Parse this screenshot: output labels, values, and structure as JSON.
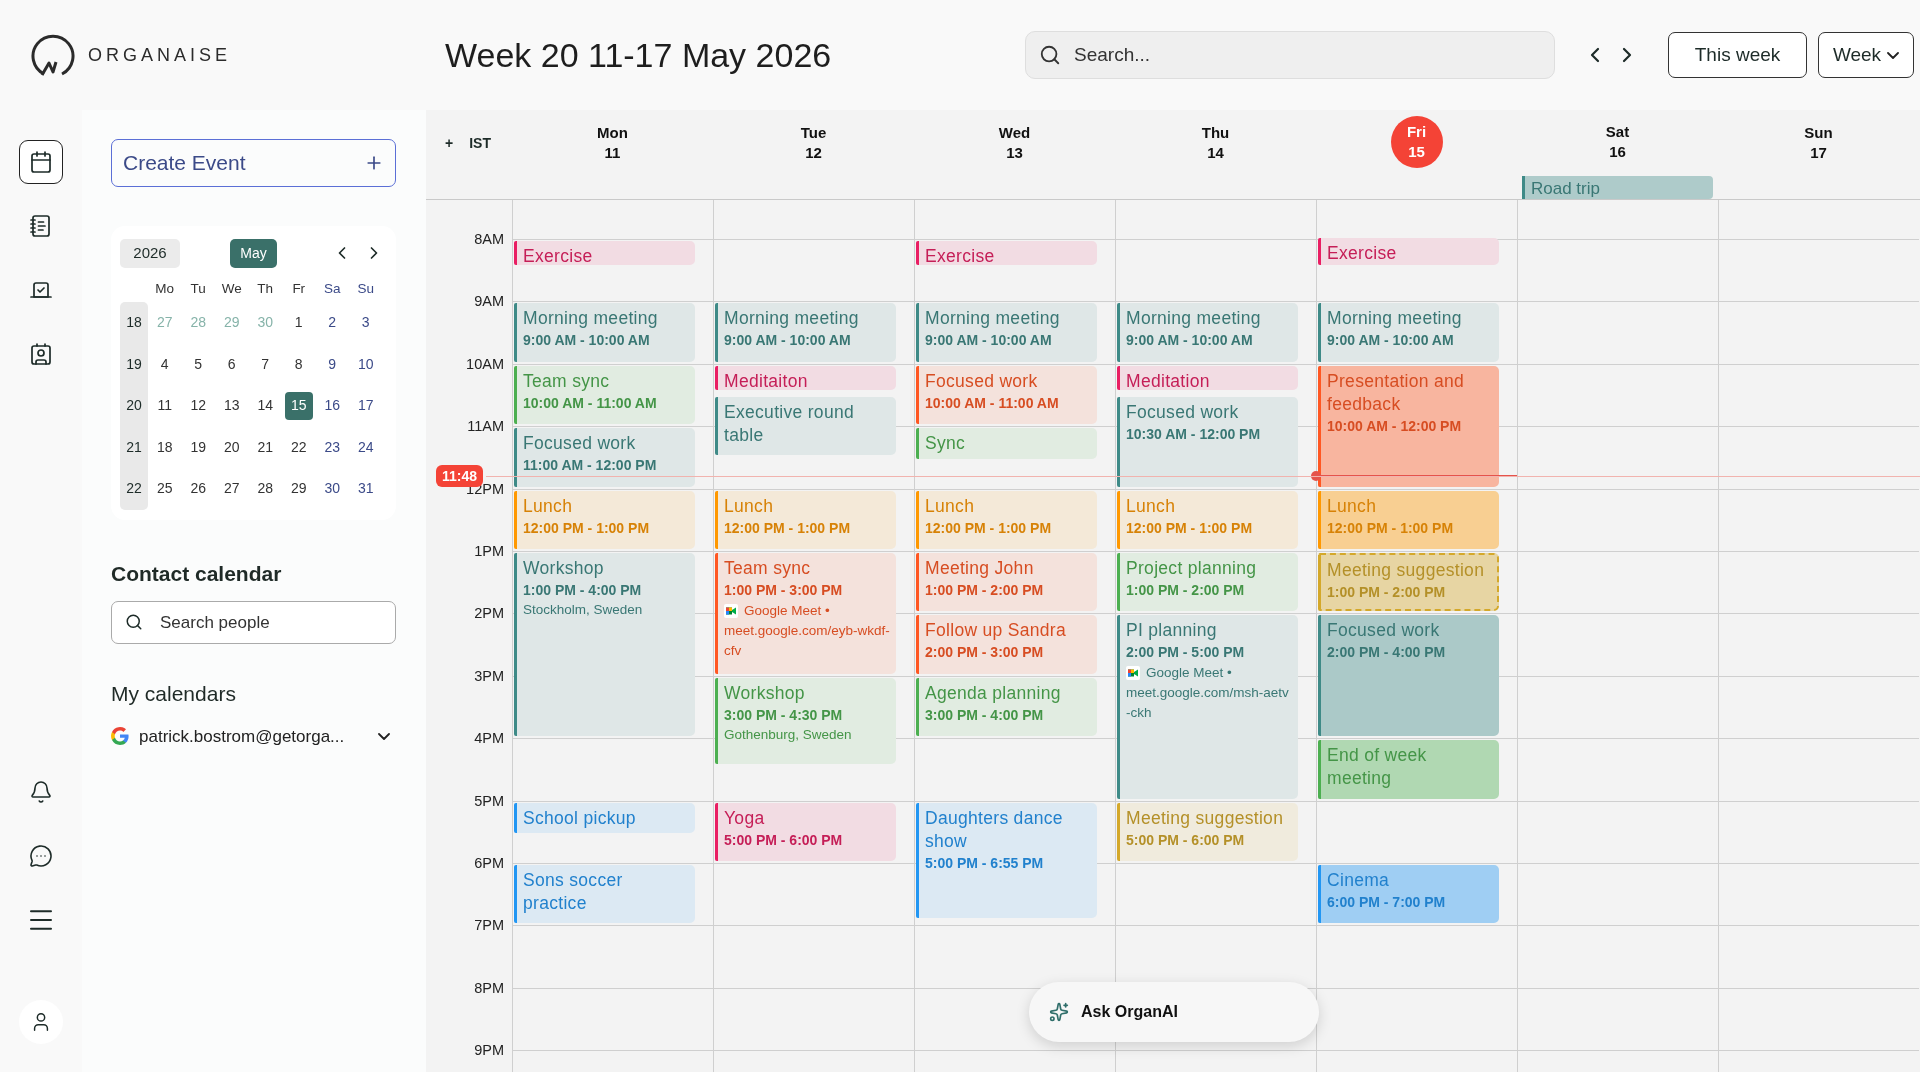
{
  "app": {
    "name": "ORGANAISE"
  },
  "header": {
    "title": "Week 20 11-17 May 2026",
    "search_placeholder": "Search...",
    "today_button": "This week",
    "view_button": "Week"
  },
  "nav_items": [
    {
      "kind": "calendar",
      "selected": true
    },
    {
      "kind": "notebook",
      "selected": false
    },
    {
      "kind": "ballot",
      "selected": false
    },
    {
      "kind": "contacts",
      "selected": false
    }
  ],
  "sidebar": {
    "create_button": "Create Event",
    "mini_calendar": {
      "year": "2026",
      "month": "May",
      "weekdays": [
        "Mo",
        "Tu",
        "We",
        "Th",
        "Fr",
        "Sa",
        "Su"
      ],
      "weeks": [
        {
          "number": "18",
          "days": [
            {
              "label": "27",
              "outside": true,
              "selected": false
            },
            {
              "label": "28",
              "outside": true,
              "selected": false
            },
            {
              "label": "29",
              "outside": true,
              "selected": false
            },
            {
              "label": "30",
              "outside": true,
              "selected": false
            },
            {
              "label": "1",
              "outside": false,
              "selected": false
            },
            {
              "label": "2",
              "outside": false,
              "selected": false
            },
            {
              "label": "3",
              "outside": false,
              "selected": false
            }
          ]
        },
        {
          "number": "19",
          "days": [
            {
              "label": "4",
              "outside": false,
              "selected": false
            },
            {
              "label": "5",
              "outside": false,
              "selected": false
            },
            {
              "label": "6",
              "outside": false,
              "selected": false
            },
            {
              "label": "7",
              "outside": false,
              "selected": false
            },
            {
              "label": "8",
              "outside": false,
              "selected": false
            },
            {
              "label": "9",
              "outside": false,
              "selected": false
            },
            {
              "label": "10",
              "outside": false,
              "selected": false
            }
          ]
        },
        {
          "number": "20",
          "days": [
            {
              "label": "11",
              "outside": false,
              "selected": false
            },
            {
              "label": "12",
              "outside": false,
              "selected": false
            },
            {
              "label": "13",
              "outside": false,
              "selected": false
            },
            {
              "label": "14",
              "outside": false,
              "selected": false
            },
            {
              "label": "15",
              "outside": false,
              "selected": true
            },
            {
              "label": "16",
              "outside": false,
              "selected": false
            },
            {
              "label": "17",
              "outside": false,
              "selected": false
            }
          ]
        },
        {
          "number": "21",
          "days": [
            {
              "label": "18",
              "outside": false,
              "selected": false
            },
            {
              "label": "19",
              "outside": false,
              "selected": false
            },
            {
              "label": "20",
              "outside": false,
              "selected": false
            },
            {
              "label": "21",
              "outside": false,
              "selected": false
            },
            {
              "label": "22",
              "outside": false,
              "selected": false
            },
            {
              "label": "23",
              "outside": false,
              "selected": false
            },
            {
              "label": "24",
              "outside": false,
              "selected": false
            }
          ]
        },
        {
          "number": "22",
          "days": [
            {
              "label": "25",
              "outside": false,
              "selected": false
            },
            {
              "label": "26",
              "outside": false,
              "selected": false
            },
            {
              "label": "27",
              "outside": false,
              "selected": false
            },
            {
              "label": "28",
              "outside": false,
              "selected": false
            },
            {
              "label": "29",
              "outside": false,
              "selected": false
            },
            {
              "label": "30",
              "outside": false,
              "selected": false
            },
            {
              "label": "31",
              "outside": false,
              "selected": false
            }
          ]
        }
      ]
    },
    "contact_heading": "Contact calendar",
    "people_placeholder": "Search people",
    "calendars_heading": "My calendars",
    "account": "patrick.bostrom@getorga..."
  },
  "calendar": {
    "add": "+",
    "timezone": "IST",
    "now": "11:48",
    "hours": [
      "8AM",
      "9AM",
      "10AM",
      "11AM",
      "12PM",
      "1PM",
      "2PM",
      "3PM",
      "4PM",
      "5PM",
      "6PM",
      "7PM",
      "8PM",
      "9PM"
    ],
    "days": [
      {
        "name": "Mon",
        "date": "11",
        "today": false,
        "events": [
          {
            "title": "Exercise",
            "color": "#e91e63",
            "highlighted": false,
            "tentative": false
          },
          {
            "title": "Morning meeting",
            "time": "9:00 AM - 10:00 AM",
            "color": "#3e8a87",
            "highlighted": false,
            "tentative": false
          },
          {
            "title": "Team sync",
            "time": "10:00 AM - 11:00 AM",
            "color": "#4caf50",
            "highlighted": false,
            "tentative": false
          },
          {
            "title": "Focused work",
            "time": "11:00 AM - 12:00 PM",
            "color": "#3e8a87",
            "highlighted": false,
            "tentative": false
          },
          {
            "title": "Lunch",
            "time": "12:00 PM - 1:00 PM",
            "color": "#ff9800",
            "highlighted": false,
            "tentative": false
          },
          {
            "title": "Workshop",
            "time": "1:00 PM - 4:00 PM",
            "location": "Stockholm, Sweden",
            "color": "#3e8a87",
            "highlighted": false,
            "tentative": false
          },
          {
            "title": "School pickup",
            "color": "#2196f3",
            "highlighted": false,
            "tentative": false
          },
          {
            "title": "Sons soccer practice",
            "color": "#2196f3",
            "highlighted": false,
            "tentative": false
          }
        ]
      },
      {
        "name": "Tue",
        "date": "12",
        "today": false,
        "events": [
          {
            "title": "Morning meeting",
            "time": "9:00 AM - 10:00 AM",
            "color": "#3e8a87",
            "highlighted": false,
            "tentative": false
          },
          {
            "title": "Meditaiton",
            "color": "#e91e63",
            "highlighted": false,
            "tentative": false
          },
          {
            "title": "Executive round table",
            "color": "#3e8a87",
            "highlighted": false,
            "tentative": false
          },
          {
            "title": "Lunch",
            "time": "12:00 PM - 1:00 PM",
            "color": "#ff9800",
            "highlighted": false,
            "tentative": false
          },
          {
            "title": "Team sync",
            "time": "1:00 PM - 3:00 PM",
            "meet": {
              "label": "Google Meet •",
              "link": "meet.google.com/eyb-wkdf-cfv"
            },
            "color": "#ff5722",
            "highlighted": false,
            "tentative": false
          },
          {
            "title": "Workshop",
            "time": "3:00 PM - 4:30 PM",
            "location": "Gothenburg, Sweden",
            "color": "#4caf50",
            "highlighted": false,
            "tentative": false
          },
          {
            "title": "Yoga",
            "time": "5:00 PM - 6:00 PM",
            "color": "#e91e63",
            "highlighted": false,
            "tentative": false
          }
        ]
      },
      {
        "name": "Wed",
        "date": "13",
        "today": false,
        "events": [
          {
            "title": "Exercise",
            "color": "#e91e63",
            "highlighted": false,
            "tentative": false
          },
          {
            "title": "Morning meeting",
            "time": "9:00 AM - 10:00 AM",
            "color": "#3e8a87",
            "highlighted": false,
            "tentative": false
          },
          {
            "title": "Focused work",
            "time": "10:00 AM - 11:00 AM",
            "color": "#ff5722",
            "highlighted": false,
            "tentative": false
          },
          {
            "title": "Sync",
            "color": "#4caf50",
            "highlighted": false,
            "tentative": false
          },
          {
            "title": "Lunch",
            "time": "12:00 PM - 1:00 PM",
            "color": "#ff9800",
            "highlighted": false,
            "tentative": false
          },
          {
            "title": "Meeting John",
            "time": "1:00 PM - 2:00 PM",
            "color": "#ff5722",
            "highlighted": false,
            "tentative": false
          },
          {
            "title": "Follow up Sandra",
            "time": "2:00 PM - 3:00 PM",
            "color": "#ff5722",
            "highlighted": false,
            "tentative": false
          },
          {
            "title": "Agenda planning",
            "time": "3:00 PM - 4:00 PM",
            "color": "#4caf50",
            "highlighted": false,
            "tentative": false
          },
          {
            "title": "Daughters dance show",
            "time": "5:00 PM - 6:55 PM",
            "color": "#2196f3",
            "highlighted": false,
            "tentative": false
          }
        ]
      },
      {
        "name": "Thu",
        "date": "14",
        "today": false,
        "events": [
          {
            "title": "Morning meeting",
            "time": "9:00 AM - 10:00 AM",
            "color": "#3e8a87",
            "highlighted": false,
            "tentative": false
          },
          {
            "title": "Meditation",
            "color": "#e91e63",
            "highlighted": false,
            "tentative": false
          },
          {
            "title": "Focused work",
            "time": "10:30 AM - 12:00 PM",
            "color": "#3e8a87",
            "highlighted": false,
            "tentative": false
          },
          {
            "title": "Lunch",
            "time": "12:00 PM - 1:00 PM",
            "color": "#ff9800",
            "highlighted": false,
            "tentative": false
          },
          {
            "title": "Project planning",
            "time": "1:00 PM - 2:00 PM",
            "color": "#4caf50",
            "highlighted": false,
            "tentative": false
          },
          {
            "title": "PI planning",
            "time": "2:00 PM - 5:00 PM",
            "meet": {
              "label": "Google Meet •",
              "link": "meet.google.com/msh-aetv-ckh"
            },
            "color": "#3e8a87",
            "highlighted": false,
            "tentative": false
          },
          {
            "title": "Meeting suggestion",
            "time": "5:00 PM - 6:00 PM",
            "color": "#d4a82a",
            "highlighted": false,
            "tentative": false
          }
        ]
      },
      {
        "name": "Fri",
        "date": "15",
        "today": true,
        "events": [
          {
            "title": "Exercise",
            "color": "#e91e63",
            "highlighted": false,
            "tentative": false
          },
          {
            "title": "Morning meeting",
            "time": "9:00 AM - 10:00 AM",
            "color": "#3e8a87",
            "highlighted": false,
            "tentative": false
          },
          {
            "title": "Presentation and feedback",
            "time": "10:00 AM - 12:00 PM",
            "color": "#ff5722",
            "highlighted": true,
            "tentative": false
          },
          {
            "title": "Lunch",
            "time": "12:00 PM - 1:00 PM",
            "color": "#ff9800",
            "highlighted": true,
            "tentative": false
          },
          {
            "title": "Meeting suggestion",
            "time": "1:00 PM - 2:00 PM",
            "color": "#d4a82a",
            "highlighted": true,
            "tentative": true
          },
          {
            "title": "Focused work",
            "time": "2:00 PM - 4:00 PM",
            "color": "#3e8a87",
            "highlighted": true,
            "tentative": false
          },
          {
            "title": "End of week meeting",
            "color": "#4caf50",
            "highlighted": true,
            "tentative": false
          },
          {
            "title": "Cinema",
            "time": "6:00 PM - 7:00 PM",
            "color": "#2196f3",
            "highlighted": true,
            "tentative": false
          }
        ]
      },
      {
        "name": "Sat",
        "date": "16",
        "today": false,
        "all_day": [
          {
            "title": "Road trip",
            "color": "#3e8a87"
          }
        ]
      },
      {
        "name": "Sun",
        "date": "17",
        "today": false
      }
    ]
  },
  "assistant": {
    "label": "Ask OrganAI"
  }
}
